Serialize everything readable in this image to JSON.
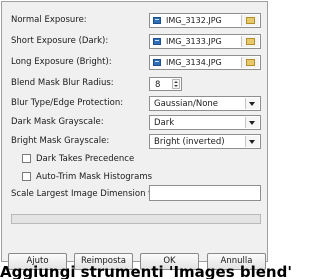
{
  "form": {
    "normal_exposure_label": "Normal Exposure:",
    "normal_exposure_file": "IMG_3132.JPG",
    "short_exposure_label": "Short Exposure (Dark):",
    "short_exposure_file": "IMG_3133.JPG",
    "long_exposure_label": "Long Exposure (Bright):",
    "long_exposure_file": "IMG_3134.JPG",
    "blend_radius_label": "Blend Mask Blur Radius:",
    "blend_radius_value": "8",
    "blur_type_label": "Blur Type/Edge Protection:",
    "blur_type_value": "Gaussian/None",
    "dark_mask_label": "Dark Mask Grayscale:",
    "dark_mask_value": "Dark",
    "bright_mask_label": "Bright Mask Grayscale:",
    "bright_mask_value": "Bright (inverted)",
    "dark_precedence_label": "Dark Takes Precedence",
    "dark_precedence_checked": false,
    "auto_trim_label": "Auto-Trim Mask Histograms",
    "auto_trim_checked": false,
    "scale_label": "Scale Largest Image Dimension to:",
    "scale_value": ""
  },
  "progress": {
    "percent": 0
  },
  "buttons": {
    "help": "Ajuto",
    "reset": "Reimposta",
    "ok": "OK",
    "cancel": "Annulla"
  },
  "overlay_text": "Aggiungi strumenti 'Images blend'",
  "icons": {
    "file": "file-image-icon",
    "browse": "folder-icon"
  },
  "colors": {
    "progress_fill": "#9fc7ef",
    "panel_bg": "#f0f0f0"
  }
}
